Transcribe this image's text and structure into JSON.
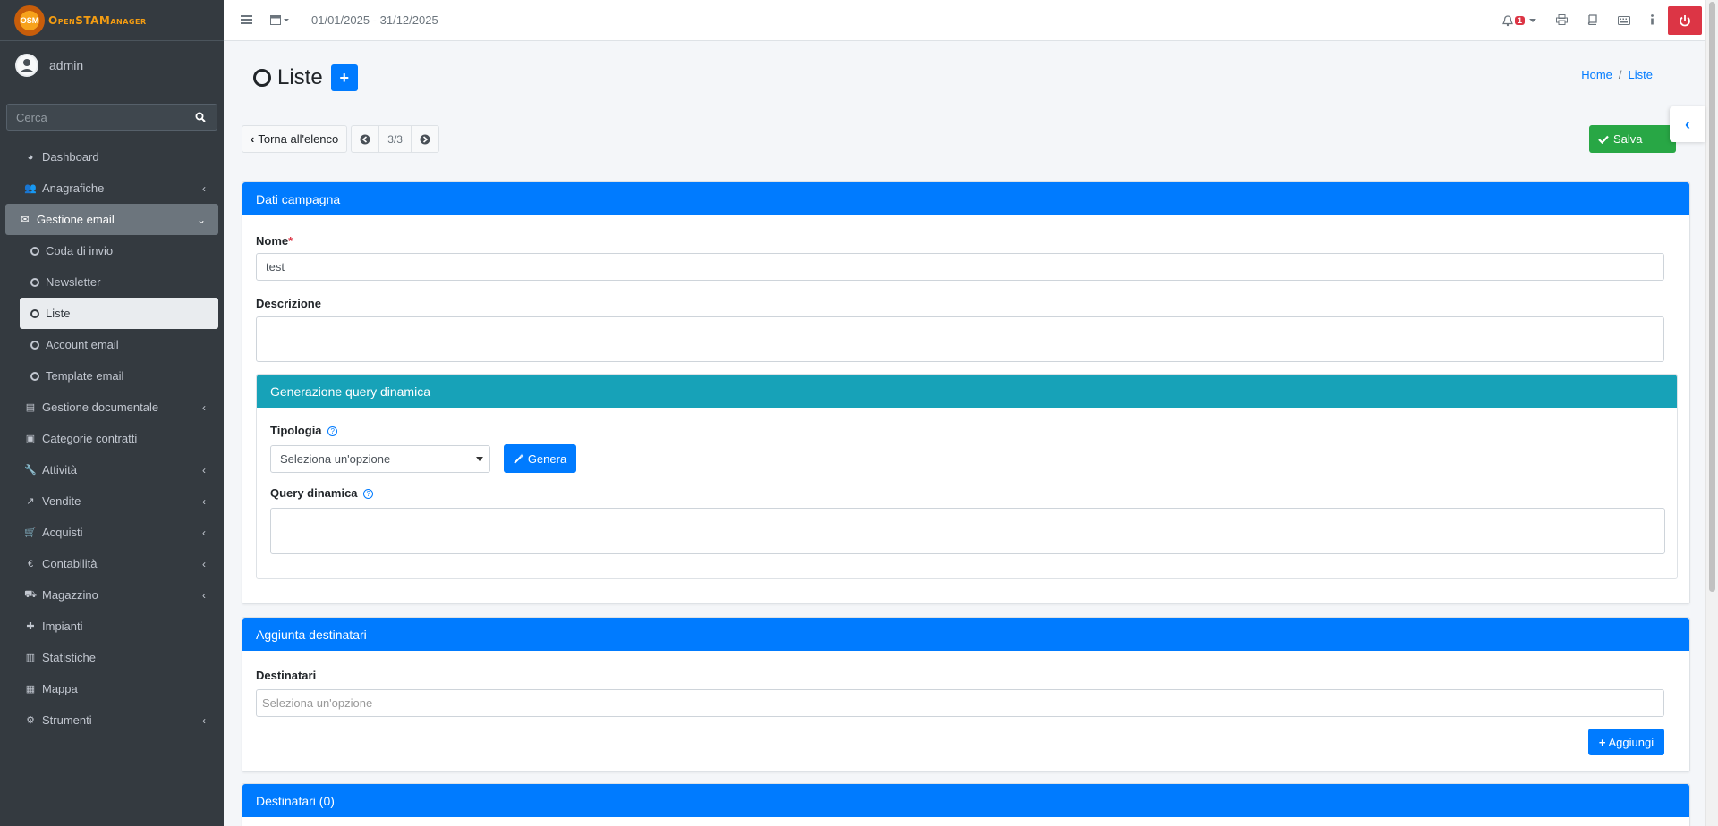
{
  "app": {
    "brand": "OpenSTAManager",
    "user": "admin",
    "date_range": "01/01/2025 - 31/12/2025",
    "notifications_count": "1"
  },
  "sidebar": {
    "search_placeholder": "Cerca",
    "items": [
      {
        "label": "Dashboard",
        "icon": "dashboard-icon"
      },
      {
        "label": "Anagrafiche",
        "icon": "users-icon"
      },
      {
        "label": "Gestione email",
        "icon": "envelope-icon"
      },
      {
        "label": "Coda di invio",
        "icon": "circle-icon"
      },
      {
        "label": "Newsletter",
        "icon": "circle-icon"
      },
      {
        "label": "Liste",
        "icon": "circle-icon"
      },
      {
        "label": "Account email",
        "icon": "circle-icon"
      },
      {
        "label": "Template email",
        "icon": "circle-icon"
      },
      {
        "label": "Gestione documentale",
        "icon": "file-icon"
      },
      {
        "label": "Categorie contratti",
        "icon": "briefcase-icon"
      },
      {
        "label": "Attività",
        "icon": "wrench-icon"
      },
      {
        "label": "Vendite",
        "icon": "chart-line-icon"
      },
      {
        "label": "Acquisti",
        "icon": "cart-icon"
      },
      {
        "label": "Contabilità",
        "icon": "euro-icon"
      },
      {
        "label": "Magazzino",
        "icon": "truck-icon"
      },
      {
        "label": "Impianti",
        "icon": "puzzle-icon"
      },
      {
        "label": "Statistiche",
        "icon": "bar-chart-icon"
      },
      {
        "label": "Mappa",
        "icon": "map-icon"
      },
      {
        "label": "Strumenti",
        "icon": "cog-icon"
      }
    ]
  },
  "page": {
    "title": "Liste",
    "breadcrumb": {
      "home": "Home",
      "current": "Liste"
    },
    "toolbar": {
      "back": "Torna all'elenco",
      "position": "3/3",
      "save": "Salva"
    }
  },
  "dati_campagna": {
    "header": "Dati campagna",
    "nome_label": "Nome",
    "nome_value": "test",
    "descrizione_label": "Descrizione",
    "descrizione_value": ""
  },
  "query_dinamica": {
    "header": "Generazione query dinamica",
    "tipologia_label": "Tipologia",
    "tipologia_placeholder": "Seleziona un'opzione",
    "genera_button": "Genera",
    "query_label": "Query dinamica",
    "query_value": ""
  },
  "aggiunta_destinatari": {
    "header": "Aggiunta destinatari",
    "destinatari_label": "Destinatari",
    "destinatari_placeholder": "Seleziona un'opzione",
    "aggiungi_button": "Aggiungi"
  },
  "destinatari_list": {
    "header": "Destinatari (0)"
  }
}
